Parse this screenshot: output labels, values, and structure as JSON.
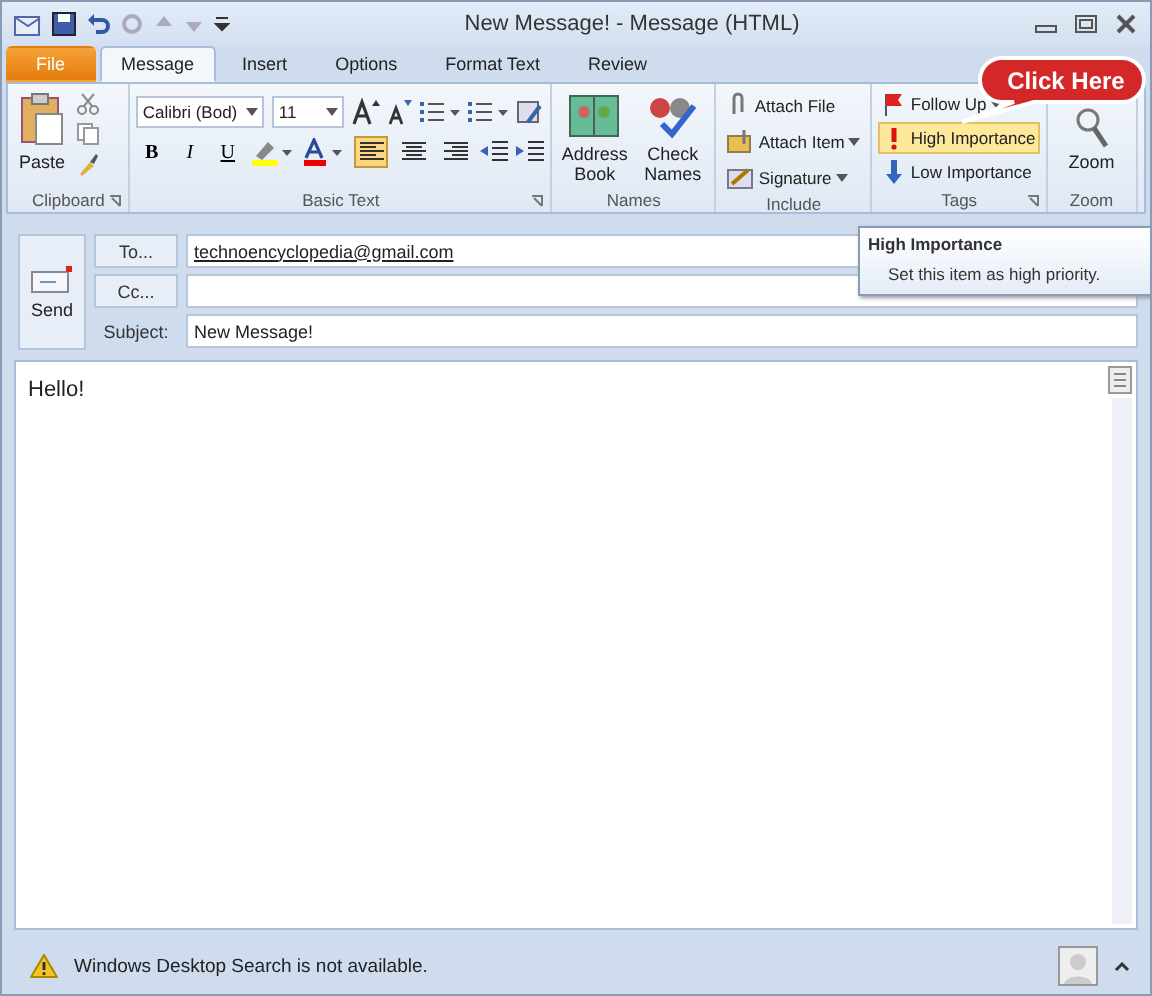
{
  "window": {
    "title": "New Message! - Message (HTML)"
  },
  "tabs": [
    {
      "label": "File",
      "kind": "file",
      "selected": false
    },
    {
      "label": "Message",
      "kind": "tab",
      "selected": true
    },
    {
      "label": "Insert",
      "kind": "tab",
      "selected": false
    },
    {
      "label": "Options",
      "kind": "tab",
      "selected": false
    },
    {
      "label": "Format Text",
      "kind": "tab",
      "selected": false
    },
    {
      "label": "Review",
      "kind": "tab",
      "selected": false
    }
  ],
  "ribbon": {
    "clipboard": {
      "label": "Clipboard",
      "paste": "Paste"
    },
    "basic_text": {
      "label": "Basic Text",
      "font": "Calibri (Bod)",
      "size": "11",
      "bold": "B",
      "italic": "I",
      "underline": "U",
      "alignment": [
        {
          "selected": true
        },
        {
          "selected": false
        },
        {
          "selected": false
        }
      ]
    },
    "names": {
      "label": "Names",
      "buttons": [
        "Address Book",
        "Check Names"
      ]
    },
    "include": {
      "label": "Include",
      "items": [
        {
          "label": "Attach File",
          "dropdown": false
        },
        {
          "label": "Attach Item",
          "dropdown": true
        },
        {
          "label": "Signature",
          "dropdown": true
        }
      ]
    },
    "tags": {
      "label": "Tags",
      "items": [
        {
          "label": "Follow Up",
          "kind": "flag",
          "dropdown": true,
          "selected": false
        },
        {
          "label": "High Importance",
          "kind": "high",
          "dropdown": false,
          "selected": true
        },
        {
          "label": "Low Importance",
          "kind": "low",
          "dropdown": false,
          "selected": false
        }
      ]
    },
    "zoom": {
      "label": "Zoom",
      "button": "Zoom"
    }
  },
  "callout": "Click Here",
  "tooltip": {
    "title": "High Importance",
    "description": "Set this item as high priority."
  },
  "send": "Send",
  "fields": [
    {
      "label": "To...",
      "kind": "button",
      "value": "technoencyclopedia@gmail.com"
    },
    {
      "label": "Cc...",
      "kind": "button"
    },
    {
      "label": "Subject:",
      "kind": "label",
      "value": "New Message!"
    }
  ],
  "body": "Hello!",
  "status_bar": {
    "text": "Windows Desktop Search is not available."
  }
}
